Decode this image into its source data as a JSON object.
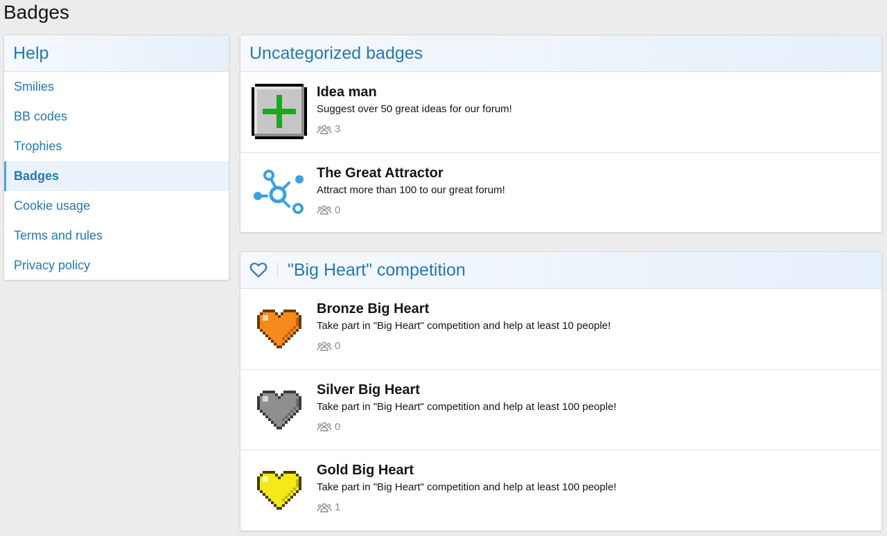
{
  "page": {
    "title": "Badges"
  },
  "sidebar": {
    "title": "Help",
    "items": [
      {
        "label": "Smilies"
      },
      {
        "label": "BB codes"
      },
      {
        "label": "Trophies"
      },
      {
        "label": "Badges",
        "active": true
      },
      {
        "label": "Cookie usage"
      },
      {
        "label": "Terms and rules"
      },
      {
        "label": "Privacy policy"
      }
    ]
  },
  "categories": [
    {
      "title": "Uncategorized badges",
      "badges": [
        {
          "name": "Idea man",
          "description": "Suggest over 50 great ideas for our forum!",
          "count": "3",
          "icon": "plus-badge-icon"
        },
        {
          "name": "The Great Attractor",
          "description": "Attract more than 100 to our great forum!",
          "count": "0",
          "icon": "network-nodes-icon"
        }
      ]
    },
    {
      "title": "\"Big Heart\" competition",
      "icon": "heart-outline-icon",
      "badges": [
        {
          "name": "Bronze Big Heart",
          "description": "Take part in \"Big Heart\" competition and help at least 10 people!",
          "count": "0",
          "icon": "bronze-heart-icon",
          "color": "#f58a1f"
        },
        {
          "name": "Silver Big Heart",
          "description": "Take part in \"Big Heart\" competition and help at least 100 people!",
          "count": "0",
          "icon": "silver-heart-icon",
          "color": "#8f8f8f"
        },
        {
          "name": "Gold Big Heart",
          "description": "Take part in \"Big Heart\" competition and help at least 100 people!",
          "count": "1",
          "icon": "gold-heart-icon",
          "color": "#f3e81a"
        }
      ]
    }
  ],
  "colors": {
    "link": "#2577b1",
    "active_border": "#47a7eb",
    "muted": "#8c8c8c"
  }
}
